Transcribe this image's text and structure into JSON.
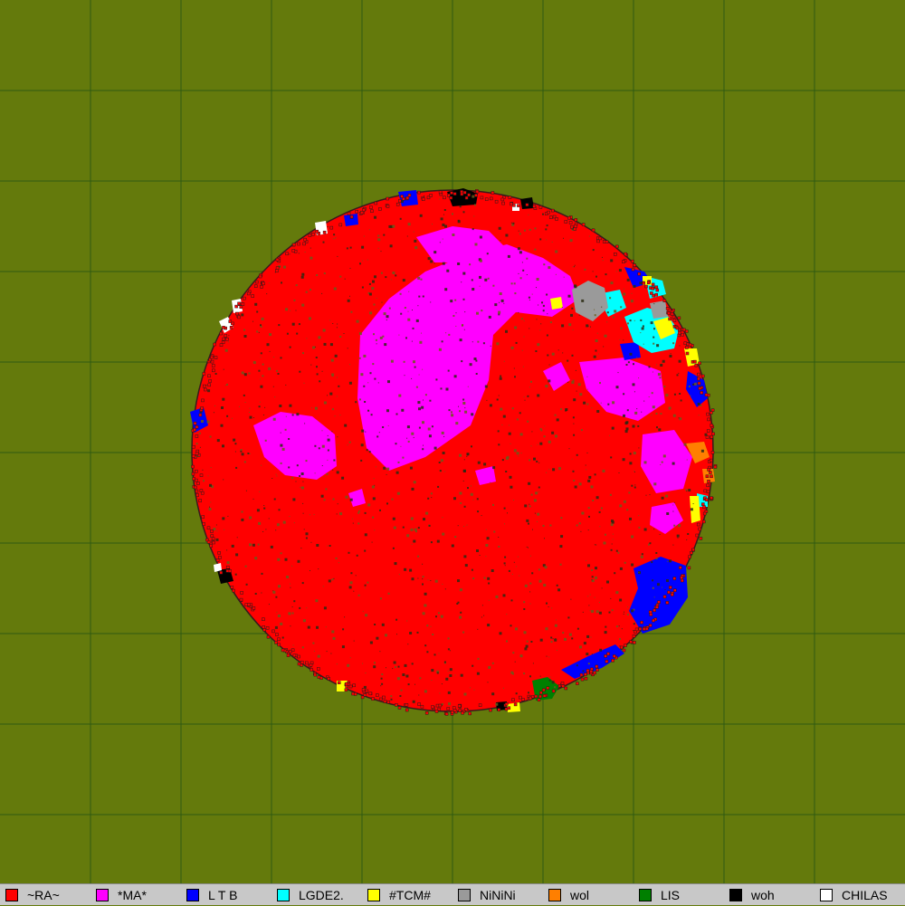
{
  "map": {
    "background_color": "#647a0c",
    "grid_color": "#2f5a12",
    "grid_divisions": 10,
    "border_color": "#1a1a1a"
  },
  "legend": {
    "players": [
      {
        "name": "~RA~",
        "color": "#ff0000",
        "territory_share": 0.78
      },
      {
        "name": "*MA*",
        "color": "#ff00ff",
        "territory_share": 0.13
      },
      {
        "name": "L T B",
        "color": "#0000ff",
        "territory_share": 0.035
      },
      {
        "name": "LGDE2.",
        "color": "#00ffff",
        "territory_share": 0.012
      },
      {
        "name": "#TCM#",
        "color": "#ffff00",
        "territory_share": 0.01
      },
      {
        "name": "NiNiNi",
        "color": "#9a9a9a",
        "territory_share": 0.006
      },
      {
        "name": "wol",
        "color": "#ff7f00",
        "territory_share": 0.004
      },
      {
        "name": "LIS",
        "color": "#007f00",
        "territory_share": 0.003
      },
      {
        "name": "woh",
        "color": "#000000",
        "territory_share": 0.004
      },
      {
        "name": "CHILAS",
        "color": "#ffffff",
        "territory_share": 0.003
      }
    ]
  }
}
